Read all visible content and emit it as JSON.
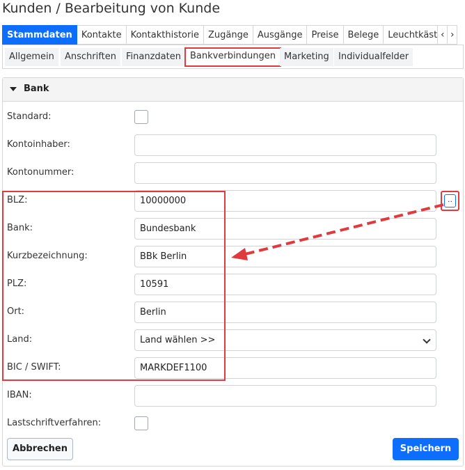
{
  "page": {
    "title": "Kunden / Bearbeitung von Kunde"
  },
  "tabs": [
    {
      "label": "Stammdaten",
      "active": true
    },
    {
      "label": "Kontakte"
    },
    {
      "label": "Kontakthistorie"
    },
    {
      "label": "Zugänge"
    },
    {
      "label": "Ausgänge"
    },
    {
      "label": "Preise"
    },
    {
      "label": "Belege"
    },
    {
      "label": "Leuchtkäst"
    }
  ],
  "tab_arrows": {
    "left": "‹",
    "right": "›"
  },
  "subtabs": [
    {
      "label": "Allgemein"
    },
    {
      "label": "Anschriften"
    },
    {
      "label": "Finanzdaten"
    },
    {
      "label": "Bankverbindungen",
      "active": true
    },
    {
      "label": "Marketing"
    },
    {
      "label": "Individualfelder"
    }
  ],
  "panel": {
    "title": "Bank"
  },
  "form": {
    "standard_label": "Standard:",
    "standard_checked": false,
    "kontoinhaber_label": "Kontoinhaber:",
    "kontoinhaber_value": "",
    "kontonummer_label": "Kontonummer:",
    "kontonummer_value": "",
    "blz_label": "BLZ:",
    "blz_value": "10000000",
    "bank_label": "Bank:",
    "bank_value": "Bundesbank",
    "kurz_label": "Kurzbezeichnung:",
    "kurz_value": "BBk Berlin",
    "plz_label": "PLZ:",
    "plz_value": "10591",
    "ort_label": "Ort:",
    "ort_value": "Berlin",
    "land_label": "Land:",
    "land_value": "Land wählen >>",
    "bic_label": "BIC / SWIFT:",
    "bic_value": "MARKDEF1100",
    "iban_label": "IBAN:",
    "iban_value": "",
    "lastschrift_label": "Lastschriftverfahren:",
    "lastschrift_checked": false
  },
  "lookup_button": {
    "label": ".."
  },
  "buttons": {
    "cancel": "Abbrechen",
    "save": "Speichern"
  },
  "colors": {
    "accent": "#0d6efd",
    "highlight": "#e0393e"
  }
}
